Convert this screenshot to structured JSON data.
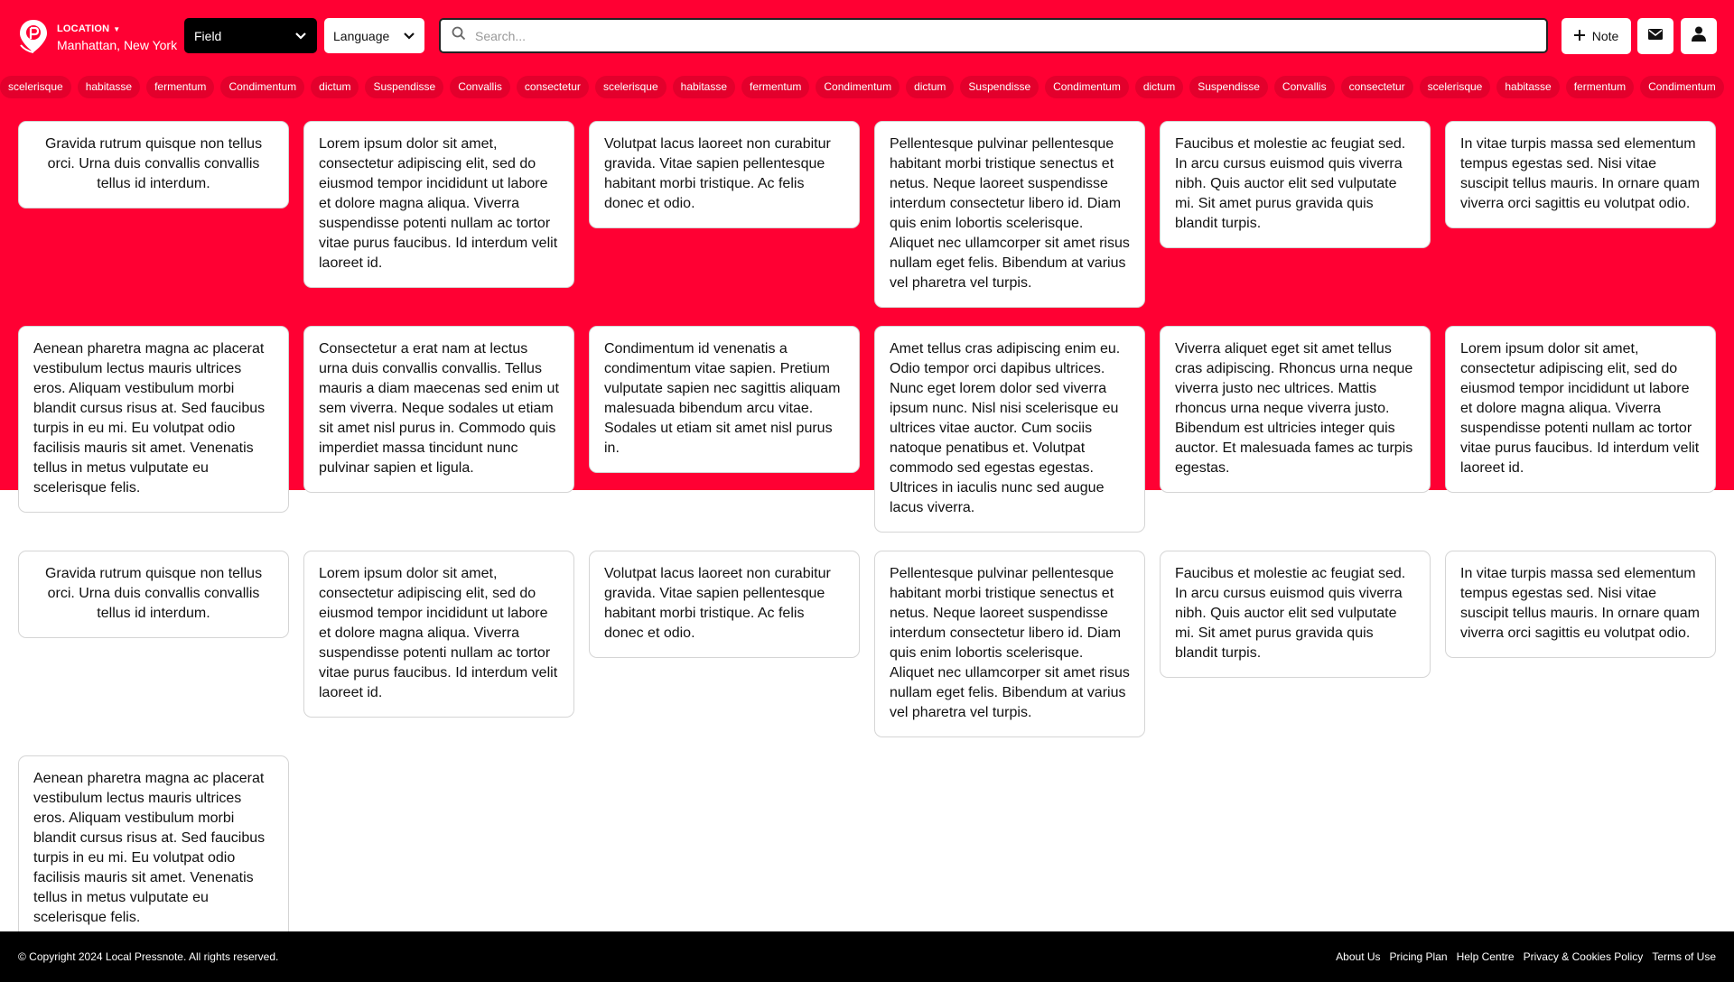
{
  "colors": {
    "brand_red": "#ff0033",
    "tag_bg": "#e3002c",
    "footer_bg": "#000000"
  },
  "header": {
    "location_label": "LOCATION",
    "location_city": "Manhattan, New York",
    "field_select": "Field",
    "language_select": "Language",
    "search_placeholder": "Search...",
    "note_label": "Note",
    "icons": [
      "pin-logo-icon",
      "caret-down-icon",
      "chevron-down-icon",
      "search-icon",
      "plus-icon",
      "envelope-icon",
      "user-icon"
    ]
  },
  "tags": [
    "scelerisque",
    "habitasse",
    "fermentum",
    "Condimentum",
    "dictum",
    "Suspendisse",
    "Convallis",
    "consectetur",
    "scelerisque",
    "habitasse",
    "fermentum",
    "Condimentum",
    "dictum",
    "Suspendisse",
    "Condimentum",
    "dictum",
    "Suspendisse",
    "Convallis",
    "consectetur",
    "scelerisque",
    "habitasse",
    "fermentum",
    "Condimentum"
  ],
  "cards": [
    {
      "text": "Gravida rutrum quisque non tellus orci. Urna duis convallis convallis tellus id interdum.",
      "centered": true
    },
    {
      "text": "Lorem ipsum dolor sit amet, consectetur adipiscing elit, sed do eiusmod tempor incididunt ut labore et dolore magna aliqua. Viverra suspendisse potenti nullam ac tortor vitae purus faucibus. Id interdum velit laoreet id."
    },
    {
      "text": "Volutpat lacus laoreet non curabitur gravida. Vitae sapien pellentesque habitant morbi tristique. Ac felis donec et odio."
    },
    {
      "text": "Pellentesque pulvinar pellentesque habitant morbi tristique senectus et netus. Neque laoreet suspendisse interdum consectetur libero id. Diam quis enim lobortis scelerisque. Aliquet nec ullamcorper sit amet risus nullam eget felis. Bibendum at varius vel pharetra vel turpis."
    },
    {
      "text": "Faucibus et molestie ac feugiat sed. In arcu cursus euismod quis viverra nibh. Quis auctor elit sed vulputate mi. Sit amet purus gravida quis blandit turpis."
    },
    {
      "text": "In vitae turpis massa sed elementum tempus egestas sed. Nisi vitae suscipit tellus mauris. In ornare quam viverra orci sagittis eu volutpat odio."
    },
    {
      "text": "Aenean pharetra magna ac placerat vestibulum lectus mauris ultrices eros. Aliquam vestibulum morbi blandit cursus risus at. Sed faucibus turpis in eu mi. Eu volutpat odio facilisis mauris sit amet. Venenatis tellus in metus vulputate eu scelerisque felis."
    },
    {
      "text": "Consectetur a erat nam at lectus urna duis convallis convallis. Tellus mauris a diam maecenas sed enim ut sem viverra. Neque sodales ut etiam sit amet nisl purus in. Commodo quis imperdiet massa tincidunt nunc pulvinar sapien et ligula."
    },
    {
      "text": "Condimentum id venenatis a condimentum vitae sapien. Pretium vulputate sapien nec sagittis aliquam malesuada bibendum arcu vitae. Sodales ut etiam sit amet nisl purus in."
    },
    {
      "text": "Amet tellus cras adipiscing enim eu. Odio tempor orci dapibus ultrices. Nunc eget lorem dolor sed viverra ipsum nunc. Nisl nisi scelerisque eu ultrices vitae auctor. Cum sociis natoque penatibus et. Volutpat commodo sed egestas egestas. Ultrices in iaculis nunc sed augue lacus viverra."
    },
    {
      "text": "Viverra aliquet eget sit amet tellus cras adipiscing. Rhoncus urna neque viverra justo nec ultrices. Mattis rhoncus urna neque viverra justo. Bibendum est ultricies integer quis auctor. Et malesuada fames ac turpis egestas."
    },
    {
      "text": "Lorem ipsum dolor sit amet, consectetur adipiscing elit, sed do eiusmod tempor incididunt ut labore et dolore magna aliqua. Viverra suspendisse potenti nullam ac tortor vitae purus faucibus. Id interdum velit laoreet id."
    },
    {
      "text": "Gravida rutrum quisque non tellus orci. Urna duis convallis convallis tellus id interdum.",
      "centered": true
    },
    {
      "text": "Lorem ipsum dolor sit amet, consectetur adipiscing elit, sed do eiusmod tempor incididunt ut labore et dolore magna aliqua. Viverra suspendisse potenti nullam ac tortor vitae purus faucibus. Id interdum velit laoreet id."
    },
    {
      "text": "Volutpat lacus laoreet non curabitur gravida. Vitae sapien pellentesque habitant morbi tristique. Ac felis donec et odio."
    },
    {
      "text": "Pellentesque pulvinar pellentesque habitant morbi tristique senectus et netus. Neque laoreet suspendisse interdum consectetur libero id. Diam quis enim lobortis scelerisque. Aliquet nec ullamcorper sit amet risus nullam eget felis. Bibendum at varius vel pharetra vel turpis."
    },
    {
      "text": "Faucibus et molestie ac feugiat sed. In arcu cursus euismod quis viverra nibh. Quis auctor elit sed vulputate mi. Sit amet purus gravida quis blandit turpis."
    },
    {
      "text": "In vitae turpis massa sed elementum tempus egestas sed. Nisi vitae suscipit tellus mauris. In ornare quam viverra orci sagittis eu volutpat odio."
    },
    {
      "text": "Aenean pharetra magna ac placerat vestibulum lectus mauris ultrices eros. Aliquam vestibulum morbi blandit cursus risus at. Sed faucibus turpis in eu mi. Eu volutpat odio facilisis mauris sit amet. Venenatis tellus in metus vulputate eu scelerisque felis."
    }
  ],
  "footer": {
    "copyright": "© Copyright 2024 Local Pressnote. All rights reserved.",
    "links": [
      "About Us",
      "Pricing Plan",
      "Help Centre",
      "Privacy & Cookies Policy",
      "Terms of Use"
    ]
  }
}
